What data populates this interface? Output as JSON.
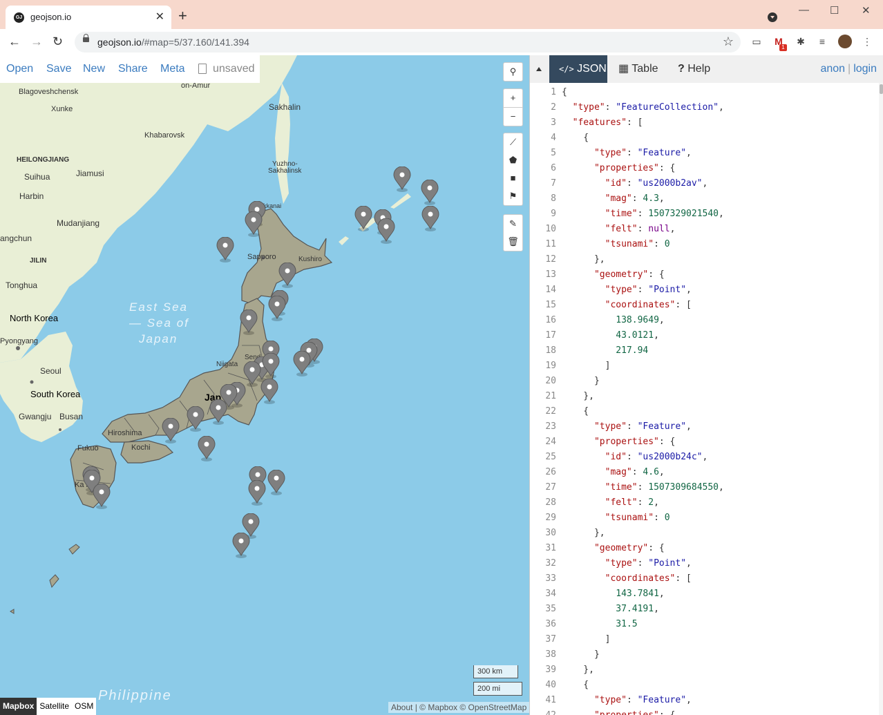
{
  "browser": {
    "tab_title": "geojson.io",
    "favicon_text": "GJ",
    "url_host": "geojson.io",
    "url_rest": "/#map=5/37.160/141.394",
    "new_tab": "+",
    "close_tab": "✕",
    "gmail_badge": "1"
  },
  "map_toolbar": {
    "open": "Open",
    "save": "Save",
    "new": "New",
    "share": "Share",
    "meta": "Meta",
    "unsaved": "unsaved"
  },
  "map": {
    "labels": {
      "blagoveshchensk": "Blagoveshchensk",
      "xunke": "Xunke",
      "khabarovsk": "Khabarovsk",
      "heilongjiang": "HEILONGJIANG",
      "jiamusi": "Jiamusi",
      "suihua": "Suihua",
      "harbin": "Harbin",
      "mudanjiang": "Mudanjiang",
      "changchun": "angchun",
      "jilin": "JILIN",
      "tonghua": "Tonghua",
      "north_korea": "North Korea",
      "pyongyang": "Pyongyang",
      "seoul": "Seoul",
      "south_korea": "South Korea",
      "gwangju": "Gwangju",
      "busan": "Busan",
      "fukuoka": "Fukuo",
      "hiroshima": "Hiroshima",
      "kochi": "Kochi",
      "kagoshima": "Ka  ima",
      "sakhalin": "Sakhalin",
      "yuzhno": "Yuzhno-\nSakhalinsk",
      "wakkanai": "Wakkanai",
      "sapporo": "Sapporo",
      "kushiro": "Kushiro",
      "niigata": "Niigata",
      "sendai": "Send",
      "japan": "Jap",
      "on_amur": "on-Amur",
      "sea1": "East Sea",
      "sea2": "— Sea of",
      "sea3": "Japan",
      "philippine": "Philippine"
    },
    "scale_km": "300 km",
    "scale_mi": "200 mi",
    "layers": [
      "Mapbox",
      "Satellite",
      "OSM"
    ],
    "attribution_about": "About",
    "attribution": " | © Mapbox © OpenStreetMap",
    "colors": {
      "sea": "#8ccbe8",
      "land": "#e9efd6",
      "japan": "#a8a68e",
      "pin": "#7f7f7f"
    }
  },
  "panel": {
    "tabs": {
      "json": "JSON",
      "table": "Table",
      "help": "Help"
    },
    "anon": "anon",
    "sep": "|",
    "login": "login",
    "lines": [
      "{",
      "  \"type\": \"FeatureCollection\",",
      "  \"features\": [",
      "    {",
      "      \"type\": \"Feature\",",
      "      \"properties\": {",
      "        \"id\": \"us2000b2av\",",
      "        \"mag\": 4.3,",
      "        \"time\": 1507329021540,",
      "        \"felt\": null,",
      "        \"tsunami\": 0",
      "      },",
      "      \"geometry\": {",
      "        \"type\": \"Point\",",
      "        \"coordinates\": [",
      "          138.9649,",
      "          43.0121,",
      "          217.94",
      "        ]",
      "      }",
      "    },",
      "    {",
      "      \"type\": \"Feature\",",
      "      \"properties\": {",
      "        \"id\": \"us2000b24c\",",
      "        \"mag\": 4.6,",
      "        \"time\": 1507309684550,",
      "        \"felt\": 2,",
      "        \"tsunami\": 0",
      "      },",
      "      \"geometry\": {",
      "        \"type\": \"Point\",",
      "        \"coordinates\": [",
      "          143.7841,",
      "          37.4191,",
      "          31.5",
      "        ]",
      "      }",
      "    },",
      "    {",
      "      \"type\": \"Feature\",",
      "      \"properties\": {"
    ]
  }
}
